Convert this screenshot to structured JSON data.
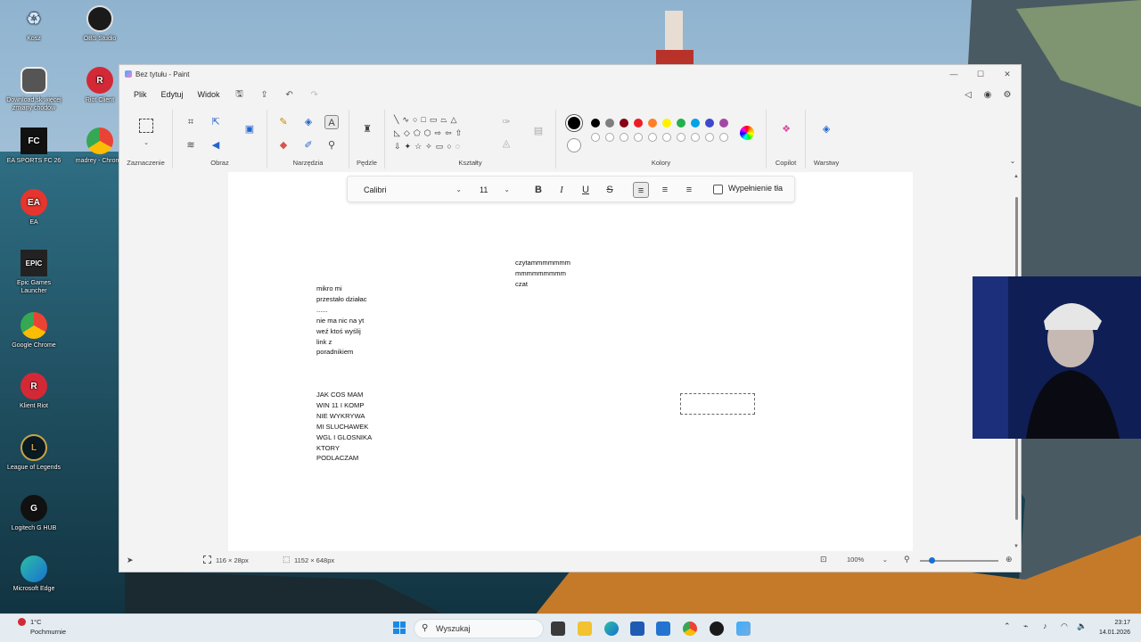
{
  "desktop": {
    "icons": [
      {
        "label": "Kosz",
        "icon": "recycle-bin-icon"
      },
      {
        "label": "OBS Studio",
        "icon": "obs-icon"
      },
      {
        "label": "Download.sk więcej\nzmiany chodów",
        "icon": "download-app-icon"
      },
      {
        "label": "Riot Client",
        "icon": "riot-icon"
      },
      {
        "label": "EA SPORTS FC 26",
        "icon": "fc26-icon"
      },
      {
        "label": "madrey - Chrome",
        "icon": "chrome-profile-icon"
      },
      {
        "label": "EA",
        "icon": "ea-icon"
      },
      {
        "label": "Epic Games\nLauncher",
        "icon": "epic-icon"
      },
      {
        "label": "Google Chrome",
        "icon": "chrome-icon"
      },
      {
        "label": "Klient Riot",
        "icon": "riot-client-icon"
      },
      {
        "label": "League of Legends",
        "icon": "lol-icon"
      },
      {
        "label": "Logitech G HUB",
        "icon": "logitech-icon"
      },
      {
        "label": "Microsoft Edge",
        "icon": "edge-icon"
      }
    ]
  },
  "paint": {
    "title": "Bez tytułu - Paint",
    "menu": {
      "file": "Plik",
      "edit": "Edytuj",
      "view": "Widok"
    },
    "groups": {
      "selection": "Zaznaczenie",
      "image": "Obraz",
      "tools": "Narzędzia",
      "brushes": "Pędzle",
      "shapes": "Kształty",
      "colors": "Kolory",
      "copilot": "Copilot",
      "layers": "Warstwy"
    },
    "palette_row1": [
      "#000000",
      "#7f7f7f",
      "#880015",
      "#ed1c24",
      "#ff7f27",
      "#fff200",
      "#22b14c",
      "#00a2e8",
      "#3f48cc",
      "#a349a4"
    ],
    "palette_row2": [
      "#ffffff",
      "#c3c3c3",
      "#b97a57",
      "#ffaec9",
      "#ffc90e",
      "#efe4b0",
      "#b5e61d",
      "#99d9ea",
      "#7092be",
      "#c8bfe7"
    ],
    "textbar": {
      "font": "Calibri",
      "size": "11",
      "fill_label": "Wypełnienie tła"
    },
    "notes": {
      "top": "czytammmmmmm\nmmmmmmmmm\nczat",
      "left1": "mikro mi\nprzestało działac\n......\nnie ma nic na yt\nweź ktoś wyślij\nlink z\nporadnikiem",
      "left2": "JAK COS MAM\nWIN 11 I KOMP\nNIE WYKRYWA\nMI SLUCHAWEK\nWGL I GLOSNIKA\nKTORY\nPODLACZAM"
    },
    "status": {
      "selection_size": "116 × 28px",
      "canvas_size": "1152 × 648px",
      "zoom": "100%"
    }
  },
  "taskbar": {
    "weather_temp": "1°C",
    "weather_desc": "Pochmurnie",
    "search_placeholder": "Wyszukaj",
    "time": "23:17",
    "date": "14.01.2026"
  }
}
